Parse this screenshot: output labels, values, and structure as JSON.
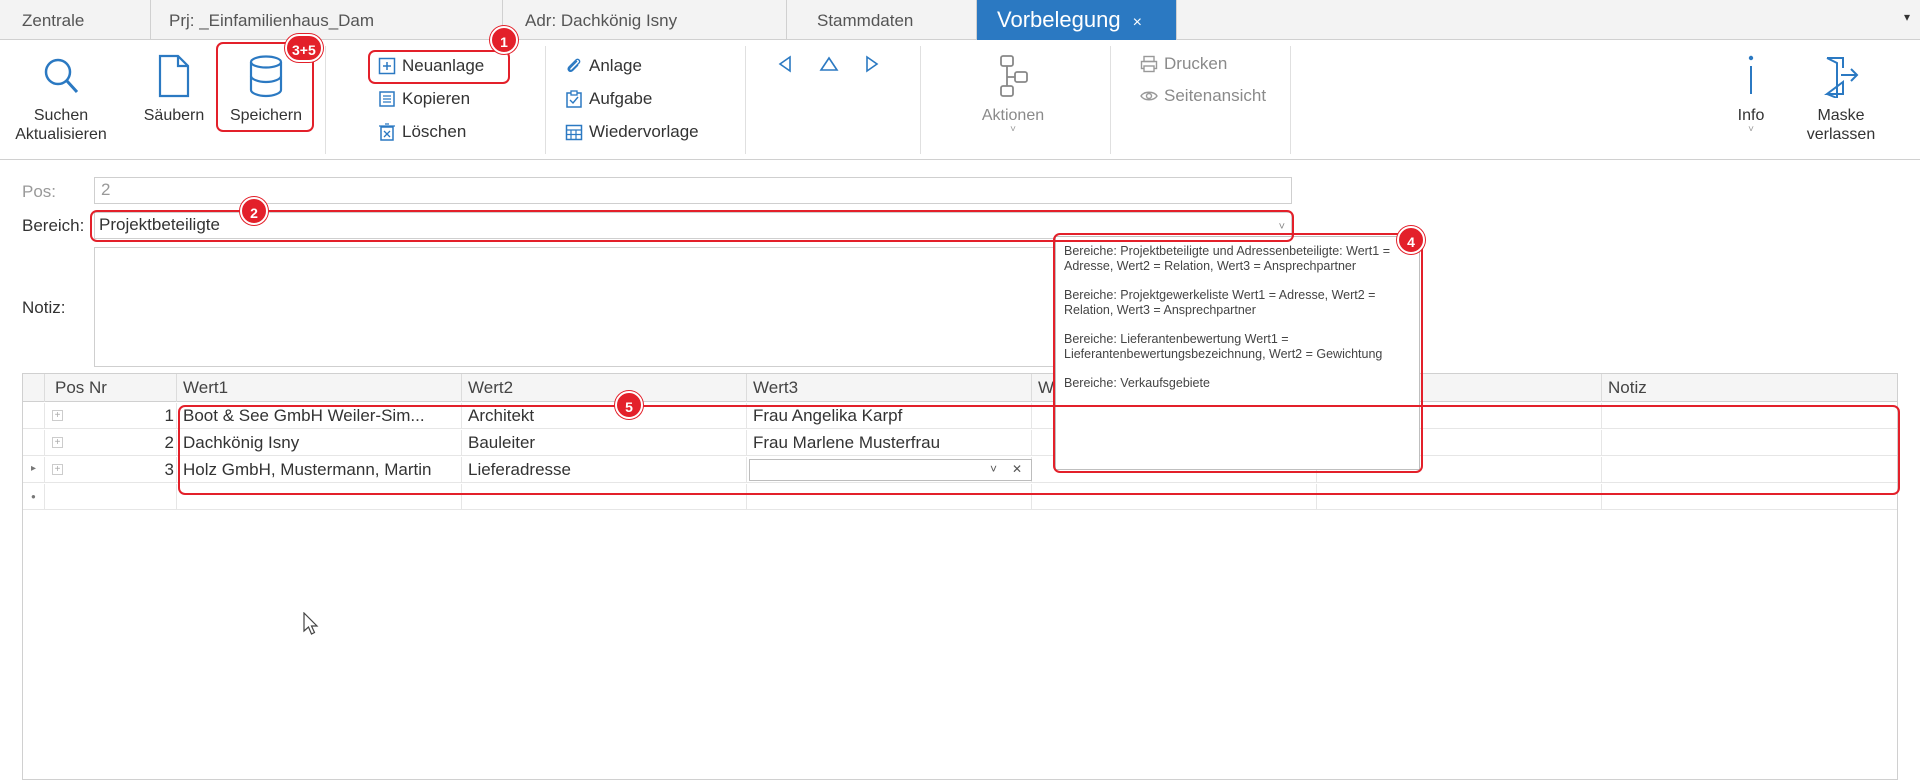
{
  "tabs": [
    {
      "label": "Zentrale"
    },
    {
      "label": "Prj: _Einfamilienhaus_Dam"
    },
    {
      "label": "Adr: Dachkönig Isny"
    },
    {
      "label": "Stammdaten"
    },
    {
      "label": "Vorbelegung",
      "close": "×",
      "active": true
    }
  ],
  "tab_dropdown": "▾",
  "ribbon": {
    "suchen": "Suchen",
    "aktualisieren": "Aktualisieren",
    "saeubern": "Säubern",
    "speichern": "Speichern",
    "neuanlage": "Neuanlage",
    "kopieren": "Kopieren",
    "loeschen": "Löschen",
    "anlage": "Anlage",
    "aufgabe": "Aufgabe",
    "wiedervorlage": "Wiedervorlage",
    "aktionen": "Aktionen",
    "drucken": "Drucken",
    "seitenansicht": "Seitenansicht",
    "info": "Info",
    "maske": "Maske",
    "verlassen": "verlassen"
  },
  "badges": {
    "b1": "1",
    "b2": "2",
    "b35": "3+5",
    "b4": "4",
    "b5": "5"
  },
  "form": {
    "pos_label": "Pos:",
    "pos_value": "2",
    "bereich_label": "Bereich:",
    "bereich_value": "Projektbeteiligte",
    "notiz_label": "Notiz:"
  },
  "tooltip": {
    "p1": "Bereiche: Projektbeteiligte und Adressenbeteiligte: Wert1 = Adresse, Wert2 = Relation, Wert3 = Ansprechpartner",
    "p2": "Bereiche: Projektgewerkeliste Wert1 = Adresse, Wert2 = Relation, Wert3 = Ansprechpartner",
    "p3": "Bereiche: Lieferantenbewertung Wert1 = Lieferantenbewertungsbezeichnung, Wert2 = Gewichtung",
    "p4": "Bereiche: Verkaufsgebiete"
  },
  "grid": {
    "headers": {
      "posnr": "Pos Nr",
      "wert1": "Wert1",
      "wert2": "Wert2",
      "wert3": "Wert3",
      "wert4": "W",
      "notiz": "Notiz"
    },
    "rows": [
      {
        "nr": "1",
        "wert1": "Boot & See GmbH Weiler-Sim...",
        "wert2": "Architekt",
        "wert3": "Frau Angelika Karpf"
      },
      {
        "nr": "2",
        "wert1": "Dachkönig Isny",
        "wert2": "Bauleiter",
        "wert3": "Frau Marlene Musterfrau"
      },
      {
        "nr": "3",
        "wert1": "Holz GmbH, Mustermann, Martin",
        "wert2": "Lieferadresse",
        "wert3": ""
      }
    ]
  },
  "colors": {
    "accent": "#2b79c2",
    "annotation": "#e3202a"
  }
}
